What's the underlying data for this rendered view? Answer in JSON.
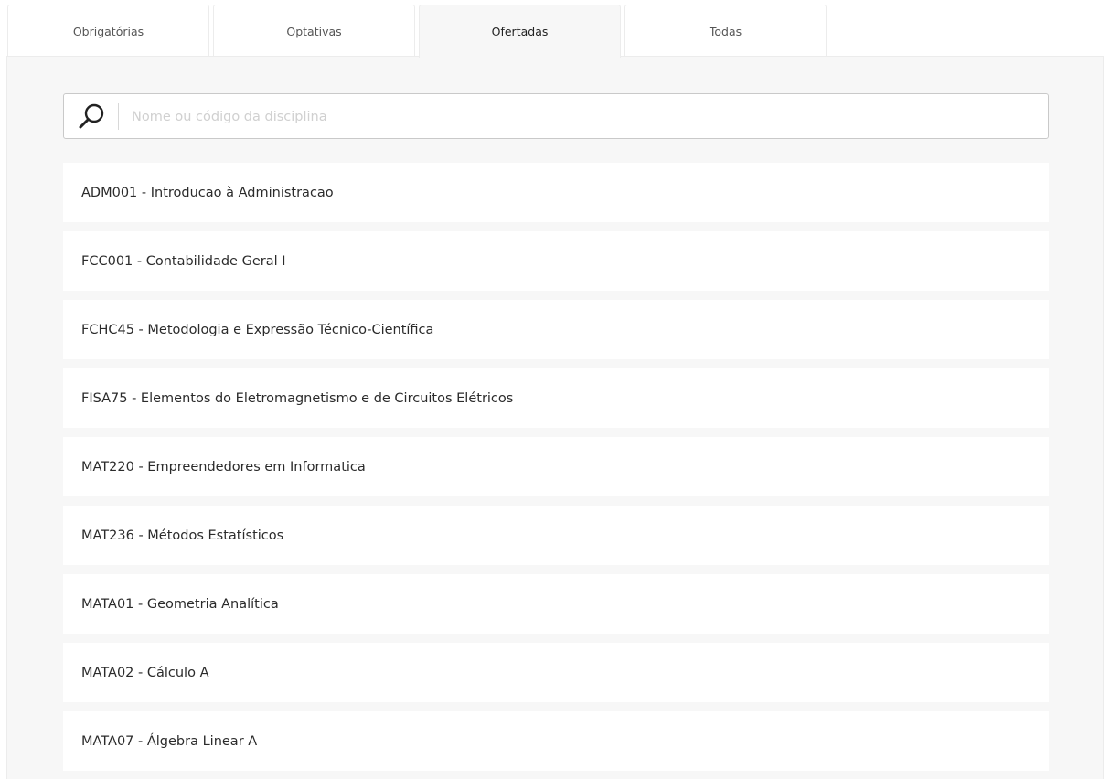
{
  "tabs": [
    {
      "label": "Obrigatórias"
    },
    {
      "label": "Optativas"
    },
    {
      "label": "Ofertadas"
    },
    {
      "label": "Todas"
    }
  ],
  "active_tab": "Ofertadas",
  "search": {
    "placeholder": "Nome ou código da disciplina",
    "value": "",
    "icon": "search-icon"
  },
  "courses": [
    {
      "label": "ADM001 - Introducao à Administracao"
    },
    {
      "label": "FCC001 - Contabilidade Geral I"
    },
    {
      "label": "FCHC45 - Metodologia e Expressão Técnico-Científica"
    },
    {
      "label": "FISA75 - Elementos do Eletromagnetismo e de Circuitos Elétricos"
    },
    {
      "label": "MAT220 - Empreendedores em Informatica"
    },
    {
      "label": "MAT236 - Métodos Estatísticos"
    },
    {
      "label": "MATA01 - Geometria Analítica"
    },
    {
      "label": "MATA02 - Cálculo A"
    },
    {
      "label": "MATA07 - Álgebra Linear A"
    }
  ],
  "colors": {
    "panel_bg": "#f7f7f7",
    "item_bg": "#ffffff",
    "border": "#ececec"
  }
}
